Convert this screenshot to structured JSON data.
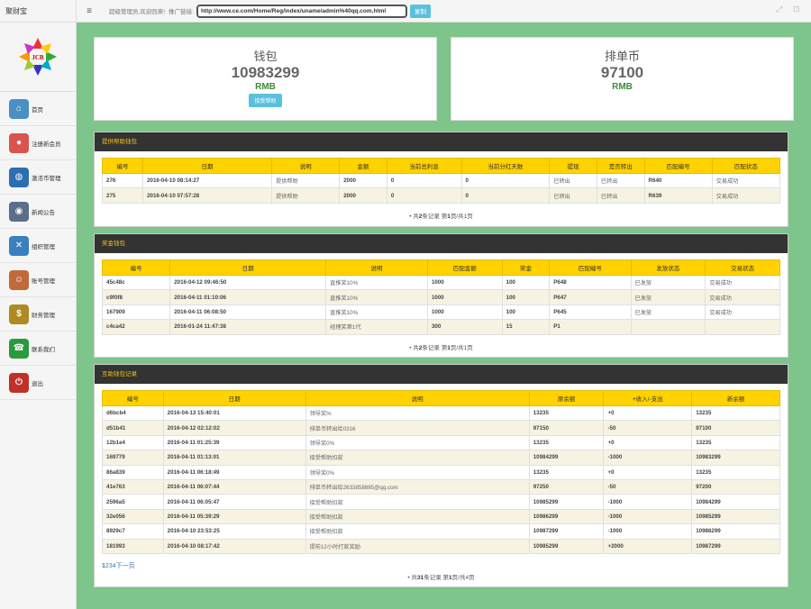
{
  "header": {
    "brand": "聚财宝",
    "welcome": "超级管理员,欢迎回来!",
    "promo_label": "推广链接:",
    "promo_url": "http://www.ce.com/Home/Reg/index/uname/admin%40qq.com.html",
    "copy_label": "复制"
  },
  "sidebar": {
    "logo_text": "JCB",
    "items": [
      {
        "label": "首页",
        "icon": "home-icon",
        "color": "#4a90c2"
      },
      {
        "label": "注册新会员",
        "icon": "register-icon",
        "color": "#d9534f"
      },
      {
        "label": "激活币管理",
        "icon": "globe-icon",
        "color": "#2a6fb0"
      },
      {
        "label": "新闻公告",
        "icon": "eye-icon",
        "color": "#5a6f8a"
      },
      {
        "label": "组织管理",
        "icon": "network-icon",
        "color": "#3a7fc0"
      },
      {
        "label": "账号管理",
        "icon": "users-icon",
        "color": "#c06a3a"
      },
      {
        "label": "财务管理",
        "icon": "dollar-icon",
        "color": "#b08a20"
      },
      {
        "label": "联系我们",
        "icon": "phone-icon",
        "color": "#2a9a3a"
      },
      {
        "label": "退出",
        "icon": "power-icon",
        "color": "#c0302a"
      }
    ]
  },
  "wallet": {
    "title": "钱包",
    "value": "10983299",
    "unit": "RMB",
    "button": "接受帮助"
  },
  "queue": {
    "title": "排单币",
    "value": "97100",
    "unit": "RMB"
  },
  "provide": {
    "title": "提供帮助钱包",
    "columns": [
      "编号",
      "日期",
      "说明",
      "金额",
      "当前总利息",
      "当前分红天数",
      "提现",
      "是否转出",
      "匹配编号",
      "匹配状态"
    ],
    "rows": [
      [
        "276",
        "2016-04-10 08:14:27",
        "提供帮助",
        "2000",
        "0",
        "0",
        "已转出",
        "已转出",
        "R640",
        "交易成功"
      ],
      [
        "275",
        "2016-04-10 07:57:28",
        "提供帮助",
        "2000",
        "0",
        "0",
        "已转出",
        "已转出",
        "R639",
        "交易成功"
      ]
    ],
    "pager": {
      "pre": "共",
      "count": "2",
      "mid": "条记录 第",
      "page": "1",
      "post": "页/共1页"
    }
  },
  "bonus": {
    "title": "奖金钱包",
    "columns": [
      "编号",
      "日期",
      "说明",
      "匹配金额",
      "奖金",
      "匹配编号",
      "发放状态",
      "交易状态"
    ],
    "rows": [
      [
        "45c48c",
        "2016-04-12 09:46:50",
        "直推奖10%",
        "1000",
        "100",
        "P648",
        "已发放",
        "交易成功"
      ],
      [
        "c9f0f8",
        "2016-04-11 01:10:06",
        "直推奖10%",
        "1000",
        "100",
        "P647",
        "已发放",
        "交易成功"
      ],
      [
        "167909",
        "2016-04-11 06:08:50",
        "直推奖10%",
        "1000",
        "100",
        "P645",
        "已发放",
        "交易成功"
      ],
      [
        "c4ca42",
        "2016-01-24 11:47:38",
        "经理奖第1代",
        "300",
        "15",
        "P1",
        "",
        ""
      ]
    ],
    "pager": {
      "pre": "共",
      "count": "2",
      "mid": "条记录 第",
      "page": "1",
      "post": "页/共1页"
    }
  },
  "mutual": {
    "title": "互助钱包记录",
    "columns": [
      "编号",
      "日期",
      "说明",
      "原余额",
      "+收入/-支出",
      "新余额"
    ],
    "rows": [
      [
        "d6bcb4",
        "2016-04-13 15:40:01",
        "领导奖%",
        "13235",
        "+0",
        "13235"
      ],
      [
        "d51b41",
        "2016-04-12 02:12:02",
        "排单币转出给0316",
        "97150",
        "-50",
        "97100"
      ],
      [
        "12b1e4",
        "2016-04-11 01:25:39",
        "领导奖0%",
        "13235",
        "+0",
        "13235"
      ],
      [
        "169779",
        "2016-04-11 01:13:01",
        "接受帮助扣款",
        "10984299",
        "-1000",
        "10983299"
      ],
      [
        "86a839",
        "2016-04-11 06:18:49",
        "领导奖0%",
        "13235",
        "+0",
        "13235"
      ],
      [
        "41e763",
        "2016-04-11 06:07:44",
        "排单币转出给2633858885@qq.com",
        "97250",
        "-50",
        "97200"
      ],
      [
        "2596a5",
        "2016-04-11 06:05:47",
        "接受帮助扣款",
        "10985299",
        "-1000",
        "10984299"
      ],
      [
        "32e056",
        "2016-04-11 05:39:29",
        "接受帮助扣款",
        "10986299",
        "-1000",
        "10985299"
      ],
      [
        "8929c7",
        "2016-04-10 23:53:25",
        "接受帮助扣款",
        "10987299",
        "-1000",
        "10986299"
      ],
      [
        "181993",
        "2016-04-10 08:17:42",
        "提前12小时打款奖励",
        "10985299",
        "+2000",
        "10987299"
      ]
    ],
    "page_links": [
      "1",
      "2",
      "3",
      "4",
      "下一页"
    ],
    "pager": {
      "pre": "共",
      "count": "31",
      "mid": "条记录 第",
      "page": "1",
      "post": "页/共4页"
    }
  }
}
